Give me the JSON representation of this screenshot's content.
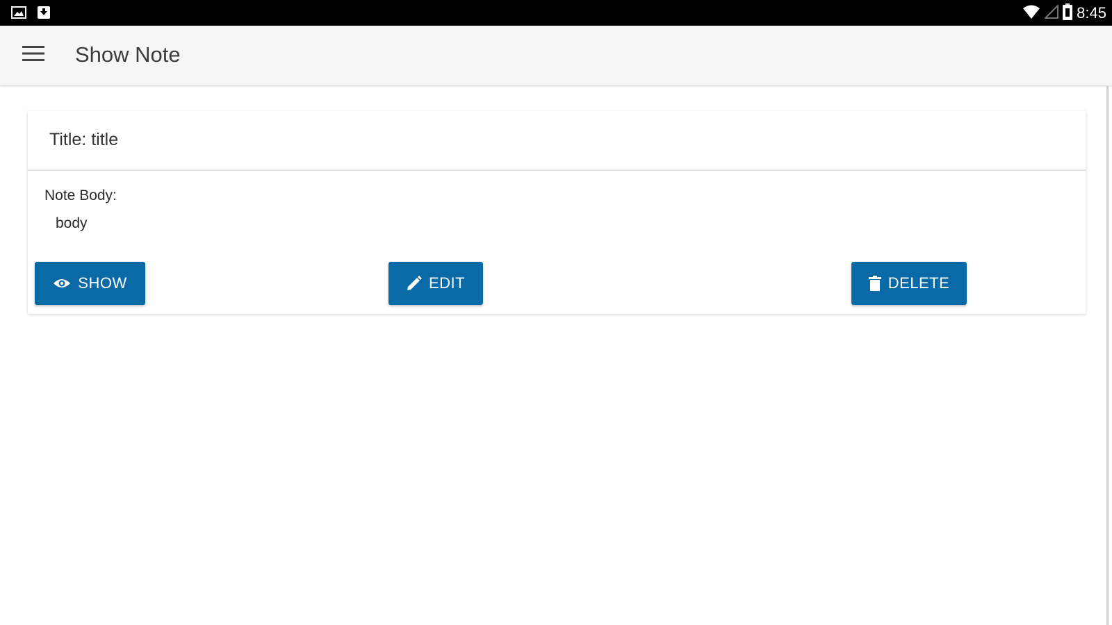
{
  "status_bar": {
    "time": "8:45",
    "icons": [
      "image-notification-icon",
      "download-notification-icon",
      "wifi-icon",
      "signal-icon",
      "battery-icon"
    ]
  },
  "app_bar": {
    "menu_icon": "hamburger-menu-icon",
    "title": "Show Note"
  },
  "note": {
    "title_line": "Title: title",
    "body_label": "Note Body:",
    "body_value": "body",
    "buttons": {
      "show": {
        "label": "SHOW",
        "icon": "eye-icon"
      },
      "edit": {
        "label": "EDIT",
        "icon": "pencil-icon"
      },
      "delete": {
        "label": "DELETE",
        "icon": "trash-icon"
      }
    }
  },
  "colors": {
    "status_bar": "#000000",
    "app_bar": "#f6f6f6",
    "accent": "#0a6aa8",
    "background": "#ffffff"
  }
}
